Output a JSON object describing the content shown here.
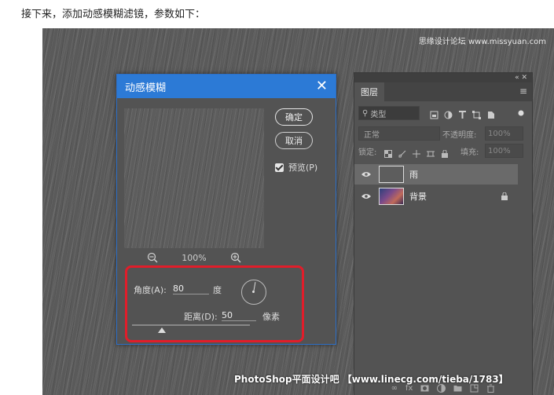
{
  "intro_text": "接下来，添加动感模糊滤镜，参数如下：",
  "watermark_top": "思缘设计论坛 www.missyuan.com",
  "watermark_bottom": "PhotoShop平面设计吧 【www.linecg.com/tieba/1783】",
  "dialog": {
    "title": "动感模糊",
    "ok_label": "确定",
    "cancel_label": "取消",
    "preview_label": "预览(P)",
    "zoom_level": "100%",
    "angle_label": "角度(A):",
    "angle_value": "80",
    "angle_unit": "度",
    "distance_label": "距离(D):",
    "distance_value": "50",
    "distance_unit": "像素"
  },
  "layers_panel": {
    "tab_label": "图层",
    "topbar_icons": "«  ✕",
    "kind_label": "类型",
    "blend_mode": "正常",
    "opacity_label": "不透明度:",
    "opacity_value": "100%",
    "lock_label": "锁定:",
    "fill_label": "填充:",
    "fill_value": "100%",
    "layers": [
      {
        "name": "雨"
      },
      {
        "name": "背景"
      }
    ]
  },
  "colors": {
    "dialog_title_bg": "#2c7ad6",
    "highlight_border": "#e11d2a",
    "panel_bg": "#535353"
  }
}
